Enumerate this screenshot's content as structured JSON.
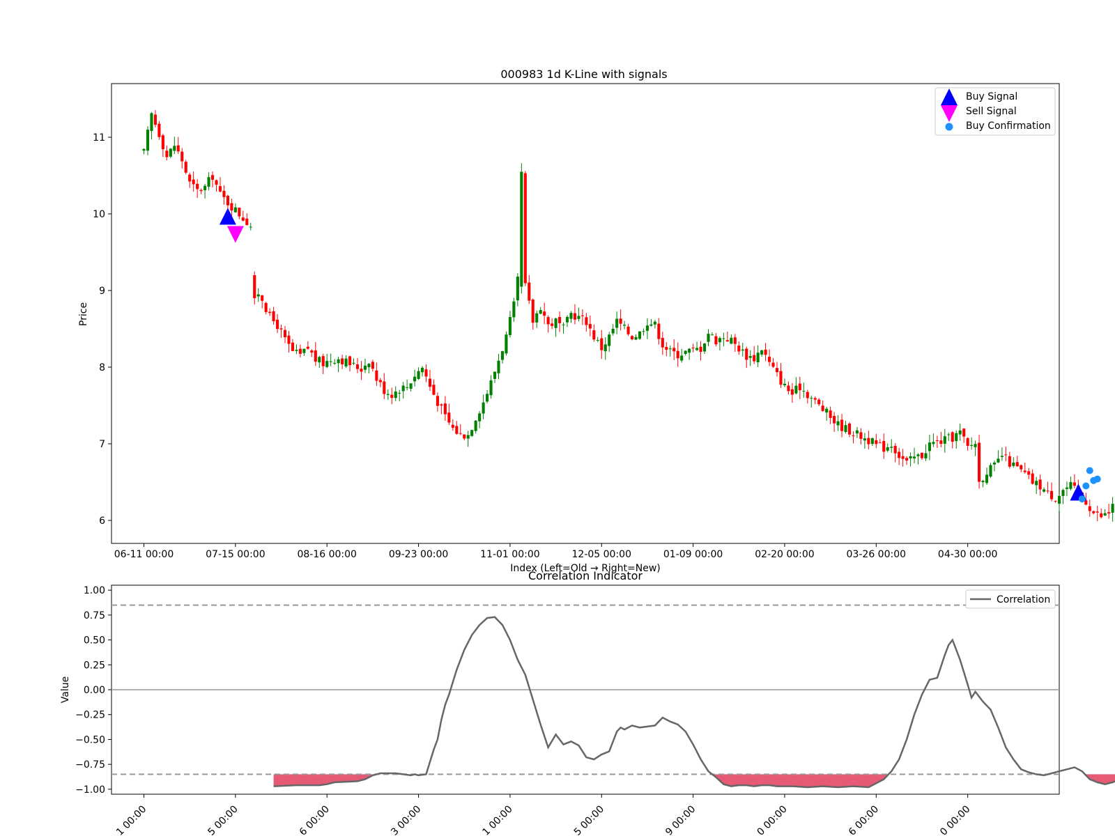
{
  "chart_data": [
    {
      "type": "candlestick",
      "title": "000983 1d K-Line with signals",
      "xlabel": "Index (Left=Old → Right=New)",
      "ylabel": "Price",
      "ylim": [
        5.7,
        11.7
      ],
      "yticks": [
        6,
        7,
        8,
        9,
        10,
        11
      ],
      "xlim": [
        -8.5,
        240
      ],
      "xticks": [
        {
          "index": 0,
          "label": "06-11 00:00"
        },
        {
          "index": 24,
          "label": "07-15 00:00"
        },
        {
          "index": 48,
          "label": "08-16 00:00"
        },
        {
          "index": 72,
          "label": "09-23 00:00"
        },
        {
          "index": 96,
          "label": "11-01 00:00"
        },
        {
          "index": 120,
          "label": "12-05 00:00"
        },
        {
          "index": 144,
          "label": "01-09 00:00"
        },
        {
          "index": 168,
          "label": "02-20 00:00"
        },
        {
          "index": 192,
          "label": "03-26 00:00"
        },
        {
          "index": 216,
          "label": "04-30 00:00"
        }
      ],
      "colors": {
        "up": "#008000",
        "down": "#ff0000",
        "buy": "#0000ff",
        "sell": "#ff00ff",
        "confirm": "#1e90ff"
      },
      "close_path": [
        [
          0,
          10.8
        ],
        [
          2,
          11.3
        ],
        [
          4,
          11.05
        ],
        [
          6,
          10.75
        ],
        [
          8,
          10.9
        ],
        [
          10,
          10.7
        ],
        [
          12,
          10.4
        ],
        [
          14,
          10.3
        ],
        [
          16,
          10.35
        ],
        [
          18,
          10.5
        ],
        [
          20,
          10.25
        ],
        [
          22,
          10.15
        ],
        [
          24,
          10.05
        ],
        [
          26,
          9.95
        ],
        [
          28,
          9.85
        ],
        [
          29,
          9.05
        ],
        [
          31,
          8.9
        ],
        [
          33,
          8.65
        ],
        [
          35,
          8.55
        ],
        [
          37,
          8.35
        ],
        [
          39,
          8.2
        ],
        [
          41,
          8.15
        ],
        [
          43,
          8.25
        ],
        [
          45,
          8.1
        ],
        [
          47,
          8.05
        ],
        [
          49,
          8.1
        ],
        [
          51,
          8.12
        ],
        [
          53,
          8.07
        ],
        [
          55,
          8.02
        ],
        [
          57,
          7.98
        ],
        [
          59,
          8.1
        ],
        [
          61,
          7.85
        ],
        [
          63,
          7.7
        ],
        [
          65,
          7.65
        ],
        [
          67,
          7.72
        ],
        [
          69,
          7.75
        ],
        [
          71,
          7.9
        ],
        [
          73,
          8.0
        ],
        [
          75,
          7.75
        ],
        [
          77,
          7.55
        ],
        [
          79,
          7.35
        ],
        [
          81,
          7.2
        ],
        [
          83,
          7.12
        ],
        [
          85,
          7.12
        ],
        [
          87,
          7.35
        ],
        [
          89,
          7.55
        ],
        [
          91,
          7.8
        ],
        [
          93,
          8.1
        ],
        [
          95,
          8.4
        ],
        [
          97,
          8.8
        ],
        [
          99,
          9.45
        ],
        [
          100,
          9.05
        ],
        [
          102,
          8.6
        ],
        [
          104,
          8.8
        ],
        [
          106,
          8.55
        ],
        [
          108,
          8.6
        ],
        [
          110,
          8.5
        ],
        [
          112,
          8.7
        ],
        [
          114,
          8.65
        ],
        [
          116,
          8.6
        ],
        [
          118,
          8.4
        ],
        [
          120,
          8.25
        ],
        [
          122,
          8.4
        ],
        [
          124,
          8.6
        ],
        [
          126,
          8.5
        ],
        [
          128,
          8.4
        ],
        [
          130,
          8.45
        ],
        [
          132,
          8.6
        ],
        [
          134,
          8.55
        ],
        [
          136,
          8.3
        ],
        [
          138,
          8.2
        ],
        [
          140,
          8.17
        ],
        [
          142,
          8.2
        ],
        [
          144,
          8.22
        ],
        [
          146,
          8.25
        ],
        [
          148,
          8.45
        ],
        [
          150,
          8.35
        ],
        [
          152,
          8.4
        ],
        [
          154,
          8.35
        ],
        [
          156,
          8.25
        ],
        [
          158,
          8.15
        ],
        [
          160,
          8.12
        ],
        [
          162,
          8.25
        ],
        [
          164,
          8.05
        ],
        [
          166,
          7.9
        ],
        [
          168,
          7.75
        ],
        [
          170,
          7.65
        ],
        [
          172,
          7.75
        ],
        [
          174,
          7.65
        ],
        [
          176,
          7.55
        ],
        [
          178,
          7.45
        ],
        [
          180,
          7.35
        ],
        [
          182,
          7.25
        ],
        [
          184,
          7.2
        ],
        [
          186,
          7.15
        ],
        [
          188,
          7.1
        ],
        [
          190,
          7.05
        ],
        [
          192,
          6.98
        ],
        [
          194,
          6.95
        ],
        [
          196,
          7.0
        ],
        [
          198,
          6.85
        ],
        [
          200,
          6.75
        ],
        [
          202,
          6.82
        ],
        [
          204,
          6.85
        ],
        [
          206,
          7.0
        ],
        [
          208,
          7.02
        ],
        [
          210,
          7.05
        ],
        [
          212,
          7.08
        ],
        [
          214,
          7.15
        ],
        [
          216,
          6.95
        ],
        [
          218,
          7.02
        ],
        [
          219,
          6.5
        ],
        [
          221,
          6.65
        ],
        [
          223,
          6.7
        ],
        [
          225,
          6.85
        ],
        [
          227,
          6.75
        ],
        [
          229,
          6.68
        ],
        [
          231,
          6.6
        ],
        [
          233,
          6.5
        ],
        [
          235,
          6.45
        ],
        [
          237,
          6.35
        ],
        [
          239,
          6.3
        ],
        [
          241,
          6.4
        ],
        [
          243,
          6.45
        ],
        [
          245,
          6.35
        ],
        [
          247,
          6.25
        ],
        [
          249,
          6.1
        ],
        [
          251,
          6.05
        ],
        [
          253,
          6.1
        ],
        [
          255,
          6.35
        ],
        [
          256,
          6.3
        ]
      ],
      "buy_signals": [
        {
          "x": 22,
          "y": 9.95
        },
        {
          "x": 245,
          "y": 6.35
        }
      ],
      "sell_signals": [
        {
          "x": 24,
          "y": 9.75
        }
      ],
      "buy_confirmations": [
        {
          "x": 246,
          "y": 6.28
        },
        {
          "x": 247,
          "y": 6.45
        },
        {
          "x": 248,
          "y": 6.65
        },
        {
          "x": 249,
          "y": 6.52
        },
        {
          "x": 250,
          "y": 6.54
        }
      ],
      "legend": {
        "position": "top-right",
        "entries": [
          "Buy Signal",
          "Sell Signal",
          "Buy Confirmation"
        ]
      }
    },
    {
      "type": "line",
      "title": "Correlation Indicator",
      "ylabel": "Value",
      "ylim": [
        -1.05,
        1.05
      ],
      "yticks": [
        -1.0,
        -0.75,
        -0.5,
        -0.25,
        0.0,
        0.25,
        0.5,
        0.75,
        1.0
      ],
      "ytick_labels": [
        "−1.00",
        "−0.75",
        "−0.50",
        "−0.25",
        "0.00",
        "0.25",
        "0.50",
        "0.75",
        "1.00"
      ],
      "xticks_visible": [
        {
          "index": 0,
          "label": "1 00:00"
        },
        {
          "index": 24,
          "label": "5 00:00"
        },
        {
          "index": 48,
          "label": "6 00:00"
        },
        {
          "index": 72,
          "label": "3 00:00"
        },
        {
          "index": 96,
          "label": "1 00:00"
        },
        {
          "index": 120,
          "label": "5 00:00"
        },
        {
          "index": 144,
          "label": "9 00:00"
        },
        {
          "index": 168,
          "label": "0 00:00"
        },
        {
          "index": 192,
          "label": "6 00:00"
        },
        {
          "index": 216,
          "label": "0 00:00"
        }
      ],
      "reference_lines": [
        0.85,
        -0.85
      ],
      "zero_line": 0,
      "series": [
        {
          "name": "Correlation",
          "color": "#666666",
          "x": [
            34,
            40,
            46,
            48,
            50,
            56,
            58,
            60,
            62,
            64,
            66,
            68,
            70,
            71,
            72,
            74,
            76,
            77,
            78,
            79,
            80,
            82,
            84,
            86,
            88,
            90,
            92,
            94,
            96,
            98,
            100,
            102,
            104,
            106,
            108,
            110,
            112,
            114,
            116,
            118,
            120,
            122,
            124,
            125,
            126,
            128,
            130,
            132,
            134,
            136,
            138,
            140,
            142,
            144,
            146,
            148,
            150,
            152,
            154,
            156,
            158,
            160,
            162,
            164,
            166,
            168,
            170,
            174,
            178,
            182,
            186,
            190,
            194,
            196,
            198,
            200,
            202,
            204,
            206,
            208,
            210,
            211,
            212,
            214,
            216,
            217,
            218,
            220,
            222,
            224,
            226,
            228,
            230,
            232,
            234,
            236,
            238,
            240,
            242,
            244,
            246,
            248,
            250,
            252,
            254,
            256
          ],
          "y": [
            -0.97,
            -0.96,
            -0.96,
            -0.95,
            -0.93,
            -0.92,
            -0.9,
            -0.86,
            -0.84,
            -0.84,
            -0.84,
            -0.85,
            -0.86,
            -0.85,
            -0.86,
            -0.85,
            -0.6,
            -0.5,
            -0.3,
            -0.15,
            -0.05,
            0.2,
            0.4,
            0.55,
            0.65,
            0.72,
            0.73,
            0.65,
            0.5,
            0.3,
            0.15,
            -0.1,
            -0.35,
            -0.58,
            -0.45,
            -0.55,
            -0.52,
            -0.56,
            -0.68,
            -0.7,
            -0.65,
            -0.62,
            -0.42,
            -0.38,
            -0.4,
            -0.36,
            -0.38,
            -0.37,
            -0.36,
            -0.28,
            -0.32,
            -0.35,
            -0.42,
            -0.55,
            -0.7,
            -0.82,
            -0.88,
            -0.95,
            -0.97,
            -0.96,
            -0.96,
            -0.97,
            -0.96,
            -0.96,
            -0.97,
            -0.97,
            -0.97,
            -0.98,
            -0.97,
            -0.98,
            -0.97,
            -0.98,
            -0.9,
            -0.82,
            -0.7,
            -0.5,
            -0.25,
            -0.05,
            0.1,
            0.12,
            0.35,
            0.45,
            0.5,
            0.3,
            0.05,
            -0.08,
            -0.02,
            -0.12,
            -0.2,
            -0.38,
            -0.58,
            -0.7,
            -0.8,
            -0.83,
            -0.85,
            -0.86,
            -0.84,
            -0.82,
            -0.8,
            -0.78,
            -0.82,
            -0.9,
            -0.93,
            -0.95,
            -0.93,
            -0.9
          ]
        }
      ],
      "fill_below": {
        "threshold": -0.85,
        "color": "#dc143c"
      },
      "legend": {
        "position": "top-right",
        "entries": [
          "Correlation"
        ]
      }
    }
  ]
}
